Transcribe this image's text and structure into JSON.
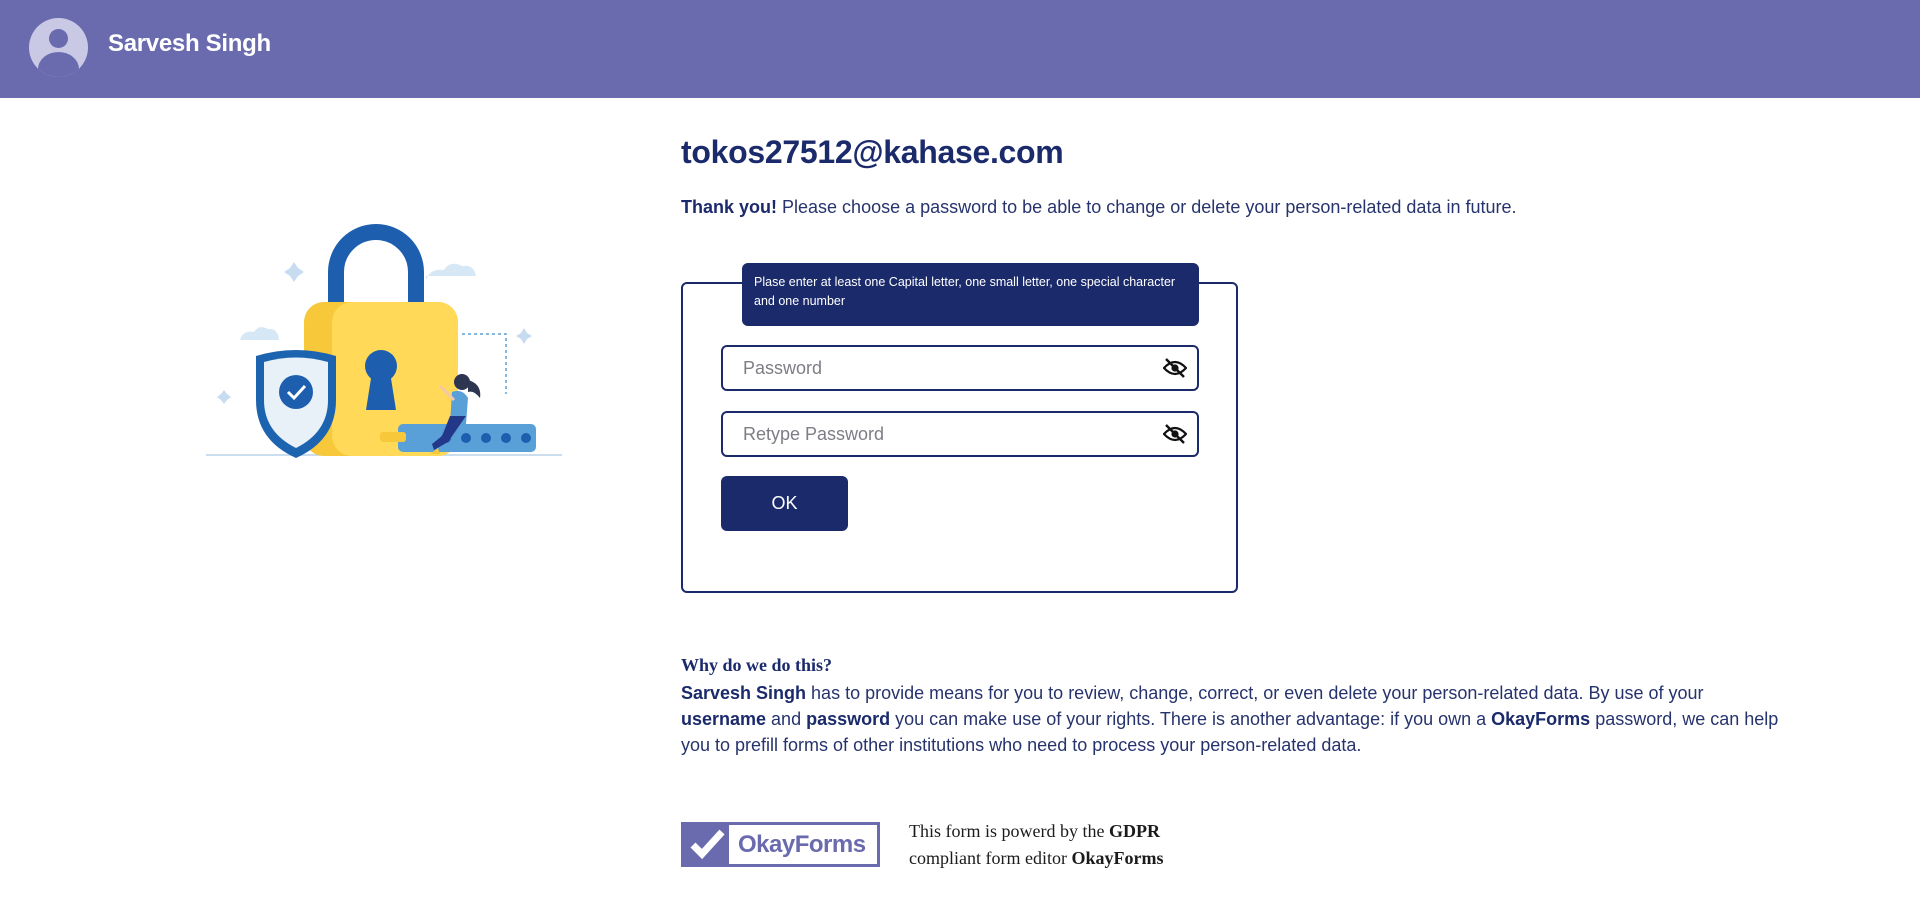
{
  "header": {
    "user_name": "Sarvesh Singh",
    "avatar_icon": "user-avatar-icon"
  },
  "main": {
    "email": "tokos27512@kahase.com",
    "intro_strong": "Thank you!",
    "intro_text": " Please choose a password to be able to change or delete your person-related data in future."
  },
  "form": {
    "tooltip": "Plase enter at least one Capital letter, one small letter, one special character and one number",
    "password_placeholder": "Password",
    "retype_placeholder": "Retype Password",
    "eye_icon": "eye-off-icon",
    "ok_label": "OK"
  },
  "why": {
    "title": "Why do we do this?",
    "p1_b1": "Sarvesh Singh",
    "p1_t1": " has to provide means for you to review, change, correct, or even delete your person-related data. By use of your ",
    "p1_b2": "username",
    "p1_t2": " and ",
    "p1_b3": "password",
    "p1_t3": " you can make use of your rights. There is another advantage: if you own a ",
    "p1_b4": "OkayForms",
    "p1_t4": " password, we can help you to prefill forms of other institutions who need to process your person-related data."
  },
  "footer": {
    "logo_text": "OkayForms",
    "powered_t1": "This form is powerd by the ",
    "powered_b1": "GDPR",
    "powered_t2": "compliant form editor ",
    "powered_b2": "OkayForms"
  },
  "colors": {
    "header_bg": "#6a6aae",
    "primary": "#1b2a6b",
    "lock_yellow": "#f7cf3f",
    "shield_blue": "#1d64b0"
  }
}
